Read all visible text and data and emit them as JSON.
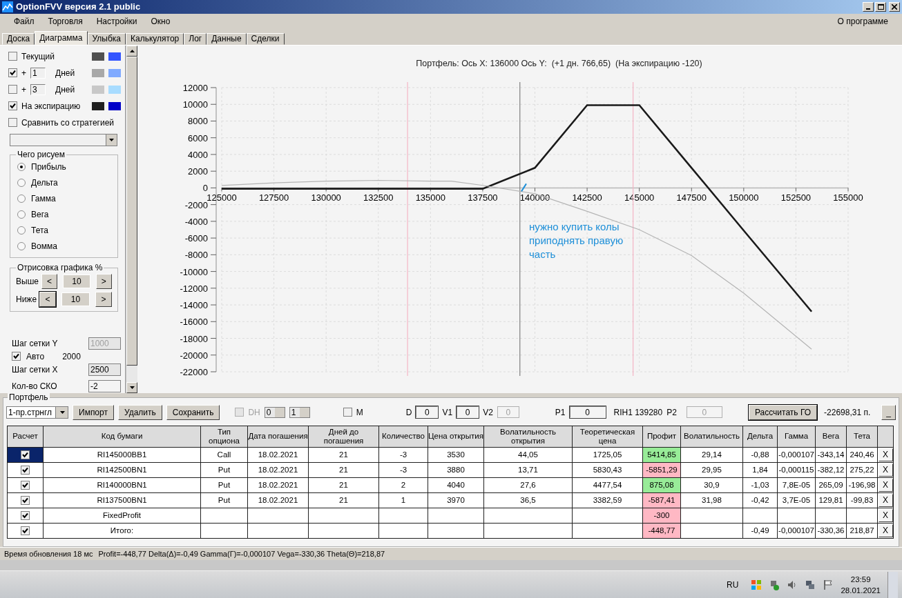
{
  "window": {
    "title": "OptionFVV версия 2.1 public"
  },
  "menu": {
    "items": [
      "Файл",
      "Торговля",
      "Настройки",
      "Окно"
    ],
    "about": "О программе"
  },
  "tabs": [
    {
      "label": "Доска",
      "selected": false
    },
    {
      "label": "Диаграмма",
      "selected": true
    },
    {
      "label": "Улыбка",
      "selected": false
    },
    {
      "label": "Калькулятор",
      "selected": false
    },
    {
      "label": "Лог",
      "selected": false
    },
    {
      "label": "Данные",
      "selected": false
    },
    {
      "label": "Сделки",
      "selected": false
    }
  ],
  "left_panel": {
    "curves": [
      {
        "label": "Текущий",
        "checked": false,
        "swatches": [
          {
            "color": "#505050"
          },
          {
            "color": "#3355ff"
          }
        ]
      },
      {
        "prefix": "+",
        "days": "1",
        "label": "Дней",
        "checked": true,
        "swatches": [
          {
            "color": "#a8a8a8"
          },
          {
            "color": "#80aaff"
          }
        ]
      },
      {
        "prefix": "+",
        "days": "3",
        "label": "Дней",
        "checked": false,
        "swatches": [
          {
            "color": "#c8c8c8"
          },
          {
            "color": "#a8dcff"
          }
        ]
      },
      {
        "label": "На экспирацию",
        "checked": true,
        "swatches": [
          {
            "color": "#202020"
          },
          {
            "color": "#0000c8"
          }
        ]
      }
    ],
    "compare": {
      "label": "Сравнить со стратегией",
      "checked": false
    },
    "draw_group": {
      "title": "Чего рисуем",
      "options": [
        {
          "label": "Прибыль",
          "selected": true
        },
        {
          "label": "Дельта",
          "selected": false
        },
        {
          "label": "Гамма",
          "selected": false
        },
        {
          "label": "Вега",
          "selected": false
        },
        {
          "label": "Тета",
          "selected": false
        },
        {
          "label": "Вомма",
          "selected": false
        }
      ]
    },
    "range_group": {
      "title": "Отрисовка графика %",
      "rows": [
        {
          "label": "Выше",
          "prev": "<",
          "value": "10",
          "next": ">",
          "focused": false
        },
        {
          "label": "Ниже",
          "prev": "<",
          "value": "10",
          "next": ">",
          "focused": true
        }
      ]
    },
    "grid_y": {
      "label": "Шаг сетки Y",
      "value": "1000",
      "disabled": true
    },
    "auto": {
      "label": "Авто",
      "checked": true,
      "value": "2000"
    },
    "grid_x": {
      "label": "Шаг сетки X",
      "value": "2500"
    },
    "sko": {
      "label": "Кол-во СКО",
      "value": "-2"
    }
  },
  "chart": {
    "chart_data": {
      "type": "line",
      "title": "Портфель: Ось X: 136000 Ось Y:  (+1 дн. 766,65)  (На экспирацию -120)",
      "x": [
        125000,
        127500,
        130000,
        132500,
        135000,
        136000,
        137500,
        140000,
        142500,
        145000,
        147500,
        150000,
        153250
      ],
      "series": [
        {
          "color": "#1a1a1a",
          "values": [
            -100,
            -100,
            -100,
            -100,
            -100,
            -100,
            -100,
            2400,
            9900,
            9900,
            2400,
            -5100,
            -14800
          ]
        },
        {
          "color": "#b4b4b4",
          "values": [
            300,
            600,
            800,
            900,
            800,
            800,
            300,
            -700,
            -2800,
            -5000,
            -8100,
            -12600,
            -19300
          ]
        }
      ],
      "grid": true,
      "xlim": [
        125000,
        155000
      ],
      "ylim": [
        -22000,
        12000
      ],
      "xticks": [
        125000,
        127500,
        130000,
        132500,
        135000,
        137500,
        140000,
        142500,
        145000,
        147500,
        150000,
        152500,
        155000
      ],
      "yticks": [
        -22000,
        -20000,
        -18000,
        -16000,
        -14000,
        -12000,
        -10000,
        -8000,
        -6000,
        -4000,
        -2000,
        0,
        2000,
        4000,
        6000,
        8000,
        10000,
        12000
      ],
      "ref_lines": [
        {
          "axis": "x",
          "value": 133900,
          "color": "#f4b4c4"
        },
        {
          "axis": "x",
          "value": 139280,
          "color": "#808080"
        },
        {
          "axis": "x",
          "value": 144700,
          "color": "#f4b4c4"
        }
      ],
      "annotations": [
        "нужно купить колы\nприподнять правую\nчасть"
      ]
    }
  },
  "portfolio": {
    "title": "Портфель",
    "strategy": "1-пр.стрнгл",
    "buttons": [
      "Импорт",
      "Удалить",
      "Сохранить"
    ],
    "dh": {
      "label": "DH",
      "checked": false,
      "disabled": true
    },
    "spinners": [
      "0",
      "1"
    ],
    "m": {
      "label": "M",
      "checked": false
    },
    "fields": [
      {
        "label": "D",
        "value": "0",
        "disabled": false
      },
      {
        "label": "V1",
        "value": "0",
        "disabled": false
      },
      {
        "label": "V2",
        "value": "0",
        "disabled": true
      },
      {
        "label": "P1",
        "value": "0",
        "disabled": false
      }
    ],
    "instrument": "RIH1 139280",
    "p2": {
      "label": "P2",
      "value": "0",
      "disabled": true
    },
    "calc_button": "Рассчитать ГО",
    "margin": "-22698,31 п.",
    "collapse_button": "_",
    "columns": [
      "Расчет",
      "Код бумаги",
      "Тип опциона",
      "Дата погашения",
      "Дней до погашения",
      "Количество",
      "Цена открытия",
      "Волатильность открытия",
      "Теоретическая цена",
      "Профит",
      "Волатильность",
      "Дельта",
      "Гамма",
      "Вега",
      "Тета"
    ],
    "rows": [
      {
        "checked": true,
        "selected": true,
        "color": "#98ec98",
        "remove": "X",
        "cells": [
          "",
          "RI145000BB1",
          "Call",
          "18.02.2021",
          "21",
          "-3",
          "3530",
          "44,05",
          "1725,05",
          "5414,85",
          "29,14",
          "-0,88",
          "-0,000107",
          "-343,14",
          "240,46"
        ]
      },
      {
        "checked": true,
        "selected": false,
        "color": "#ffb8c4",
        "remove": "X",
        "cells": [
          "",
          "RI142500BN1",
          "Put",
          "18.02.2021",
          "21",
          "-3",
          "3880",
          "13,71",
          "5830,43",
          "-5851,29",
          "29,95",
          "1,84",
          "-0,000115",
          "-382,12",
          "275,22"
        ]
      },
      {
        "checked": true,
        "selected": false,
        "color": "#98ec98",
        "remove": "X",
        "cells": [
          "",
          "RI140000BN1",
          "Put",
          "18.02.2021",
          "21",
          "2",
          "4040",
          "27,6",
          "4477,54",
          "875,08",
          "30,9",
          "-1,03",
          "7,8E-05",
          "265,09",
          "-196,98"
        ]
      },
      {
        "checked": true,
        "selected": false,
        "color": "#ffb8c4",
        "remove": "X",
        "cells": [
          "",
          "RI137500BN1",
          "Put",
          "18.02.2021",
          "21",
          "1",
          "3970",
          "36,5",
          "3382,59",
          "-587,41",
          "31,98",
          "-0,42",
          "3,7E-05",
          "129,81",
          "-99,83"
        ]
      },
      {
        "checked": true,
        "selected": false,
        "color": "#ffb8c4",
        "remove": "X",
        "cells": [
          "",
          "FixedProfit",
          "",
          "",
          "",
          "",
          "",
          "",
          "",
          "-300",
          "",
          "",
          "",
          "",
          ""
        ]
      },
      {
        "checked": true,
        "selected": false,
        "color": "#ffb8c4",
        "remove": "X",
        "cells": [
          "",
          "Итого:",
          "",
          "",
          "",
          "",
          "",
          "",
          "",
          "-448,77",
          "",
          "-0,49",
          "-0,000107",
          "-330,36",
          "218,87"
        ]
      }
    ]
  },
  "status_bar": {
    "update_time": "Время обновления 18 мс",
    "summary": "Profit=-448,77 Delta(Δ)=-0,49 Gamma(Γ)=-0,000107 Vega=-330,36 Theta(Θ)=218,87"
  },
  "taskbar": {
    "language": "RU",
    "time": "23:59",
    "date": "28.01.2021"
  }
}
